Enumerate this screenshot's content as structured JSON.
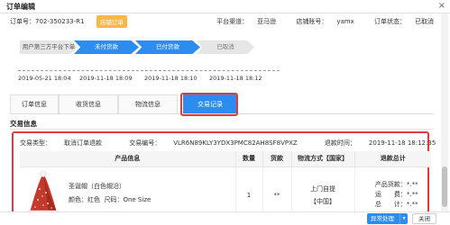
{
  "window": {
    "title": "订单编辑",
    "close": "×"
  },
  "order": {
    "label": "订单号：",
    "number": "702-350233-R1",
    "badge": "店铺订单",
    "platform_label": "平台渠道：",
    "platform": "亚马逊",
    "shop_label": "店铺账号：",
    "shop": "yamx",
    "status_label": "订单状态：",
    "status": "已取消"
  },
  "steps": [
    "用户第三方平台下单",
    "未付货款",
    "已付货款",
    "已取消"
  ],
  "timeline": [
    "2019-05-21 18:04",
    "2019-11-18 18:09",
    "2019-11-18 18:10",
    "2019-11-18 18:12"
  ],
  "tabs": [
    "订单信息",
    "收货信息",
    "物流信息",
    "交易记录"
  ],
  "transaction": {
    "section_title": "交易信息",
    "type_label": "交易类型：",
    "type": "取消订单退款",
    "id_label": "交易编号：",
    "id": "VLR6N89KLY3YDX3PMC82AH8SF8VPXZ",
    "time_label": "退款时间：",
    "time": "2019-11-18 18:12:35"
  },
  "table": {
    "headers": [
      "产品信息",
      "数量",
      "货款",
      "物流方式【国家】",
      "退款总计"
    ],
    "row": {
      "name": "圣诞帽（白色帽沿）",
      "color_label": "颜色：",
      "color": "红色",
      "size_label": "尺码：",
      "size": "One Size",
      "qty": "1",
      "price": "**",
      "shipping": "上门自提",
      "country": "【中国】",
      "totals": {
        "goods_label": "产品货款：",
        "goods_value": "*.**",
        "freight_label": "运　　费：",
        "freight_value": "*.**",
        "total_label": "总　　计：",
        "total_value": "*.**"
      }
    }
  },
  "footer": {
    "primary": "异常处理",
    "caret": "▾",
    "close": "关闭"
  },
  "colors": {
    "accent": "#2d8cf0",
    "badge": "#f7b84a",
    "highlight": "#e03c3c"
  }
}
